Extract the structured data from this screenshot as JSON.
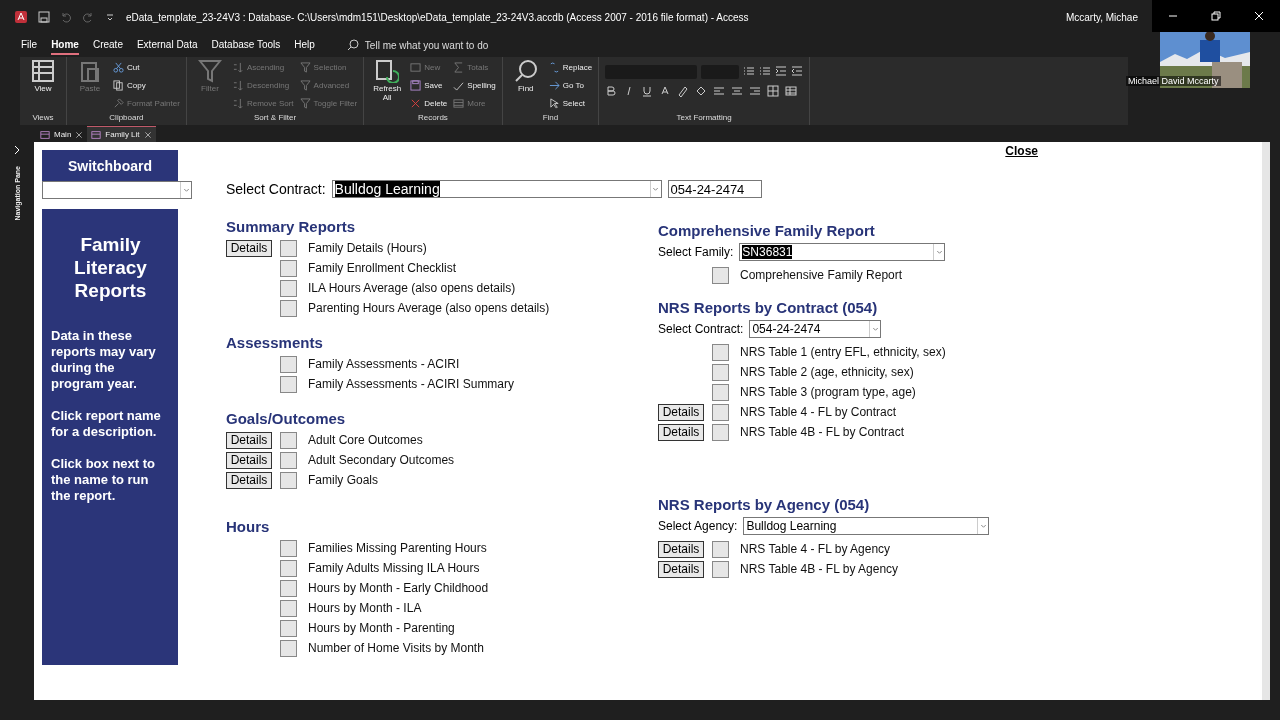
{
  "title_bar": {
    "title": "eData_template_23-24V3 : Database- C:\\Users\\mdm151\\Desktop\\eData_template_23-24V3.accdb (Access 2007 - 2016 file format)  -  Access",
    "user": "Mccarty, Michae"
  },
  "video_tile": {
    "name": "Michael David Mccarty"
  },
  "menu_tabs": [
    {
      "label": "File",
      "selected": false
    },
    {
      "label": "Home",
      "selected": true
    },
    {
      "label": "Create",
      "selected": false
    },
    {
      "label": "External Data",
      "selected": false
    },
    {
      "label": "Database Tools",
      "selected": false
    },
    {
      "label": "Help",
      "selected": false
    }
  ],
  "tell_me": {
    "placeholder": "Tell me what you want to do"
  },
  "ribbon_groups": [
    {
      "label": "Views",
      "commands": [
        {
          "kind": "large",
          "label": "View",
          "disabled": false
        }
      ]
    },
    {
      "label": "Clipboard",
      "commands": [
        {
          "kind": "large",
          "label": "Paste",
          "disabled": true
        },
        {
          "kind": "small",
          "label": "Cut",
          "disabled": false
        },
        {
          "kind": "small",
          "label": "Copy",
          "disabled": false
        },
        {
          "kind": "small",
          "label": "Format Painter",
          "disabled": true
        }
      ]
    },
    {
      "label": "Sort & Filter",
      "commands": [
        {
          "kind": "large",
          "label": "Filter",
          "disabled": true
        },
        {
          "kind": "small",
          "label": "Ascending",
          "disabled": true
        },
        {
          "kind": "small",
          "label": "Descending",
          "disabled": true
        },
        {
          "kind": "small",
          "label": "Remove Sort",
          "disabled": true
        },
        {
          "kind": "small",
          "label": "Selection",
          "disabled": true
        },
        {
          "kind": "small",
          "label": "Advanced",
          "disabled": true
        },
        {
          "kind": "small",
          "label": "Toggle Filter",
          "disabled": true
        }
      ]
    },
    {
      "label": "Records",
      "commands": [
        {
          "kind": "large",
          "label": "Refresh All",
          "disabled": false
        },
        {
          "kind": "small",
          "label": "New",
          "disabled": true
        },
        {
          "kind": "small",
          "label": "Save",
          "disabled": false
        },
        {
          "kind": "small",
          "label": "Delete",
          "disabled": false
        },
        {
          "kind": "small",
          "label": "Totals",
          "disabled": true
        },
        {
          "kind": "small",
          "label": "Spelling",
          "disabled": false
        },
        {
          "kind": "small",
          "label": "More",
          "disabled": true
        }
      ]
    },
    {
      "label": "Find",
      "commands": [
        {
          "kind": "large",
          "label": "Find",
          "disabled": false
        },
        {
          "kind": "small",
          "label": "Replace",
          "disabled": false
        },
        {
          "kind": "small",
          "label": "Go To",
          "disabled": false
        },
        {
          "kind": "small",
          "label": "Select",
          "disabled": false
        }
      ]
    },
    {
      "label": "Text Formatting"
    }
  ],
  "doc_tabs": [
    {
      "label": "Main",
      "selected": false
    },
    {
      "label": "Family Lit",
      "selected": true
    }
  ],
  "navigation_pane": {
    "label": "Navigation Pane"
  },
  "form": {
    "close": "Close",
    "switchboard": {
      "title": "Switchboard"
    },
    "side_panel": {
      "title": "Family Literacy Reports",
      "paragraphs": [
        "Data in these reports may vary during the program year.",
        "Click report name for a description.",
        "Click box next to the name to run the report."
      ]
    },
    "contract": {
      "label": "Select Contract:",
      "value": "Bulldog Learning",
      "number": "054-24-2474"
    },
    "left_sections": [
      {
        "title": "Summary Reports",
        "items": [
          {
            "label": "Family Details (Hours)",
            "details": "Details",
            "checked": false
          },
          {
            "label": "Family Enrollment Checklist",
            "checked": false
          },
          {
            "label": "ILA Hours Average (also opens details)",
            "checked": false
          },
          {
            "label": "Parenting Hours Average (also opens details)",
            "checked": false
          }
        ]
      },
      {
        "title": "Assessments",
        "items": [
          {
            "label": "Family Assessments - ACIRI",
            "checked": false
          },
          {
            "label": "Family Assessments - ACIRI Summary",
            "checked": false
          }
        ]
      },
      {
        "title": "Goals/Outcomes",
        "items": [
          {
            "label": "Adult Core Outcomes",
            "details": "Details",
            "checked": false
          },
          {
            "label": "Adult Secondary Outcomes",
            "details": "Details",
            "checked": false
          },
          {
            "label": "Family Goals",
            "details": "Details",
            "checked": false
          }
        ]
      },
      {
        "title": "Hours",
        "items": [
          {
            "label": "Families Missing Parenting Hours",
            "checked": false
          },
          {
            "label": "Family Adults Missing ILA Hours",
            "checked": false
          },
          {
            "label": "Hours by Month - Early Childhood",
            "checked": false
          },
          {
            "label": "Hours by Month - ILA",
            "checked": false
          },
          {
            "label": "Hours by Month - Parenting",
            "checked": false
          },
          {
            "label": "Number of Home Visits by Month",
            "checked": false
          }
        ]
      }
    ],
    "right_sections": [
      {
        "title": "Comprehensive Family Report",
        "select": {
          "label": "Select Family:",
          "value": "SN36831",
          "highlighted": true
        },
        "items": [
          {
            "label": "Comprehensive Family Report",
            "checked": false
          }
        ]
      },
      {
        "title": "NRS Reports by Contract (054)",
        "select": {
          "label": "Select Contract:",
          "value": "054-24-2474",
          "highlighted": false
        },
        "items": [
          {
            "label": "NRS Table 1 (entry EFL, ethnicity, sex)",
            "checked": false
          },
          {
            "label": "NRS Table 2 (age, ethnicity, sex)",
            "checked": false
          },
          {
            "label": "NRS Table 3 (program type, age)",
            "checked": false
          },
          {
            "label": "NRS Table 4 - FL by Contract",
            "details": "Details",
            "checked": false
          },
          {
            "label": "NRS Table 4B - FL by Contract",
            "details": "Details",
            "checked": false
          }
        ]
      },
      {
        "title": "NRS Reports by Agency (054)",
        "select": {
          "label": "Select Agency:",
          "value": "Bulldog Learning",
          "highlighted": false
        },
        "items": [
          {
            "label": "NRS Table 4 - FL by Agency",
            "details": "Details",
            "checked": false
          },
          {
            "label": "NRS Table 4B - FL by Agency",
            "details": "Details",
            "checked": false
          }
        ]
      }
    ]
  }
}
